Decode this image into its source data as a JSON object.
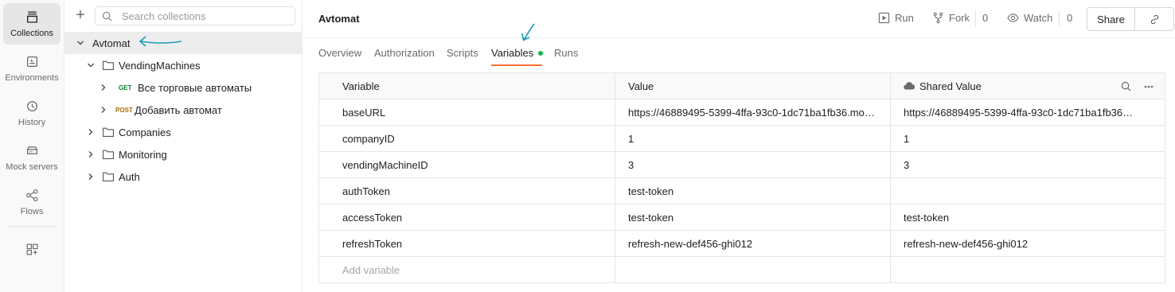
{
  "rail": {
    "items": [
      {
        "label": "Collections",
        "icon": "collections-icon",
        "active": true
      },
      {
        "label": "Environments",
        "icon": "environments-icon"
      },
      {
        "label": "History",
        "icon": "history-icon"
      },
      {
        "label": "Mock servers",
        "icon": "mock-servers-icon"
      },
      {
        "label": "Flows",
        "icon": "flows-icon"
      }
    ],
    "extra_icon": "apps-add-icon"
  },
  "sidebar": {
    "search_placeholder": "Search collections",
    "collection": "Avtomat",
    "folders": [
      {
        "name": "VendingMachines",
        "expanded": true,
        "requests": [
          {
            "method": "GET",
            "name": "Все торговые автоматы"
          },
          {
            "method": "POST",
            "name": "Добавить автомат"
          }
        ]
      },
      {
        "name": "Companies"
      },
      {
        "name": "Monitoring"
      },
      {
        "name": "Auth"
      }
    ]
  },
  "header": {
    "title": "Avtomat",
    "run_label": "Run",
    "fork_label": "Fork",
    "fork_count": "0",
    "watch_label": "Watch",
    "watch_count": "0",
    "share_label": "Share"
  },
  "tabs": [
    {
      "label": "Overview"
    },
    {
      "label": "Authorization"
    },
    {
      "label": "Scripts"
    },
    {
      "label": "Variables",
      "active": true
    },
    {
      "label": "Runs"
    }
  ],
  "table": {
    "headers": {
      "variable": "Variable",
      "value": "Value",
      "shared": "Shared Value"
    },
    "rows": [
      {
        "variable": "baseURL",
        "value": "https://46889495-5399-4ffa-93c0-1dc71ba1fb36.mo…",
        "shared": "https://46889495-5399-4ffa-93c0-1dc71ba1fb36…"
      },
      {
        "variable": "companyID",
        "value": "1",
        "shared": "1"
      },
      {
        "variable": "vendingMachineID",
        "value": "3",
        "shared": "3"
      },
      {
        "variable": "authToken",
        "value": "test-token",
        "shared": ""
      },
      {
        "variable": "accessToken",
        "value": "test-token",
        "shared": "test-token"
      },
      {
        "variable": "refreshToken",
        "value": "refresh-new-def456-ghi012",
        "shared": "refresh-new-def456-ghi012"
      }
    ],
    "add_placeholder": "Add variable"
  },
  "colors": {
    "accent": "#ff6c37",
    "active_dot": "#0cbb52",
    "annotation_arrow": "#1a9bb8"
  }
}
